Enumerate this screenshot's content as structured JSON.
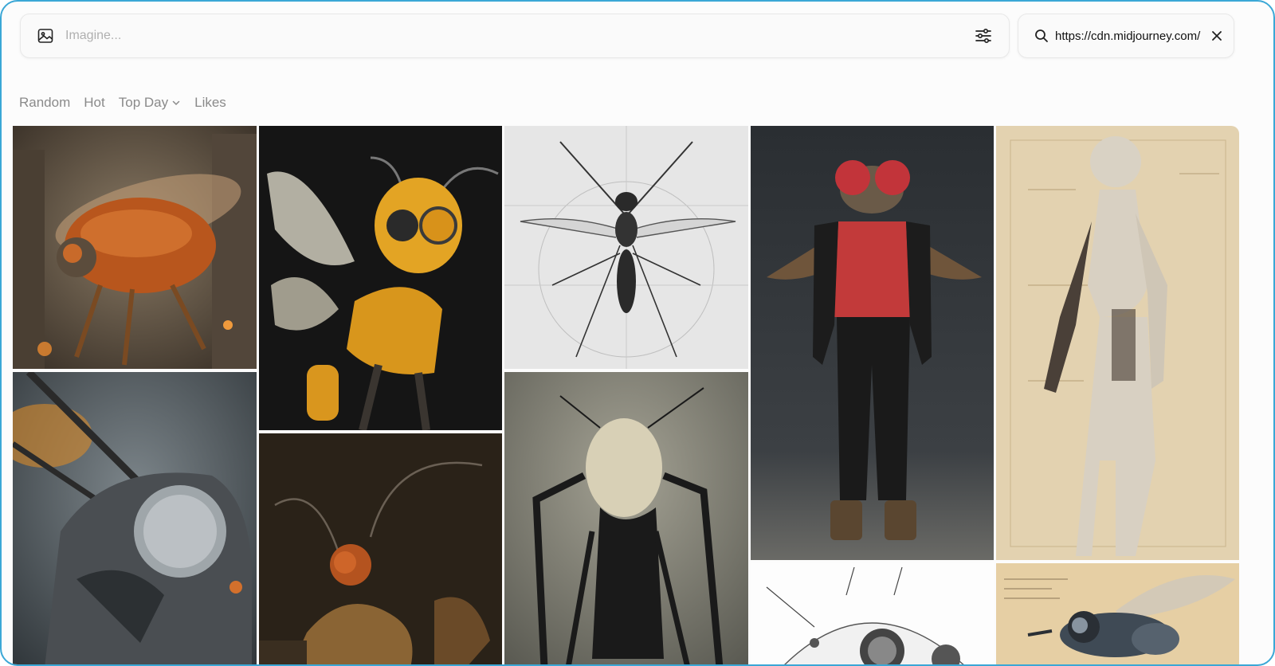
{
  "prompt_bar": {
    "placeholder": "Imagine...",
    "image_icon": "image-icon",
    "settings_icon": "sliders-icon"
  },
  "search_bar": {
    "value": "https://cdn.midjourney.com/",
    "search_icon": "search-icon",
    "clear_icon": "close-icon"
  },
  "filters": {
    "random": "Random",
    "hot": "Hot",
    "top_day": "Top Day",
    "likes": "Likes"
  },
  "gallery": {
    "tiles": [
      {
        "subject": "robot-beetle-city",
        "palette": [
          "#6b5a48",
          "#c3591c"
        ]
      },
      {
        "subject": "robot-bee-yellow",
        "palette": [
          "#1a1a1a",
          "#d79a1c"
        ]
      },
      {
        "subject": "mosquito-sketch",
        "palette": [
          "#e5e5e5",
          "#2a2a2a"
        ]
      },
      {
        "subject": "fly-man-red-vest",
        "palette": [
          "#2c3034",
          "#c23a3a"
        ]
      },
      {
        "subject": "cyborg-woman-blueprint",
        "palette": [
          "#e5d4b3",
          "#d8d0c2"
        ]
      },
      {
        "subject": "mech-fly-closeup",
        "palette": [
          "#4f555a",
          "#c9c9c9"
        ]
      },
      {
        "subject": "robot-ant-rust",
        "palette": [
          "#2a2218",
          "#9a5a22"
        ]
      },
      {
        "subject": "insect-creature-grey",
        "palette": [
          "#8a8678",
          "#1a1a1a"
        ]
      },
      {
        "subject": "bug-sketch-white",
        "palette": [
          "#ffffff",
          "#333333"
        ]
      },
      {
        "subject": "robot-bee-blueprint",
        "palette": [
          "#e6cfa4",
          "#3f4a55"
        ]
      }
    ]
  }
}
